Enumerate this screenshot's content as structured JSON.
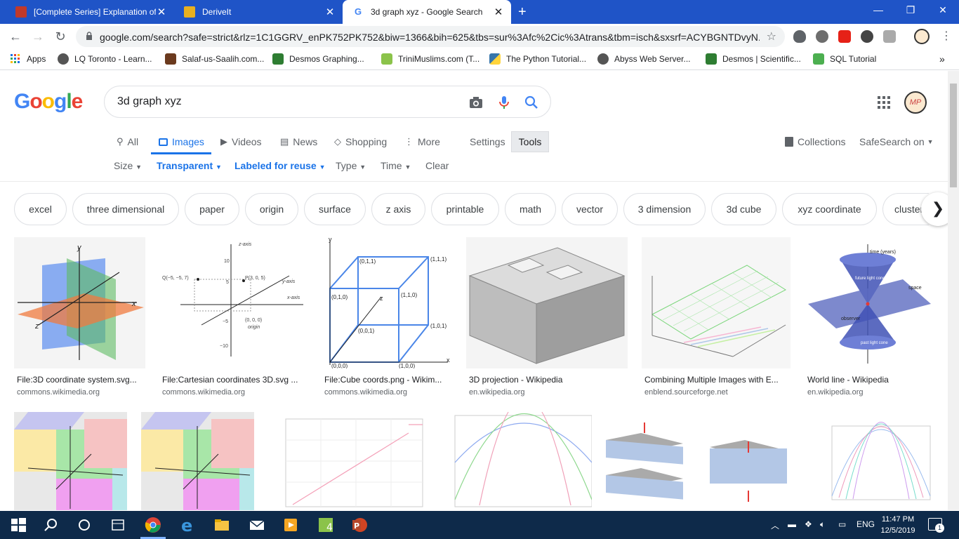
{
  "browser": {
    "tabs": [
      {
        "title": "[Complete Series] Explanation of",
        "active": false
      },
      {
        "title": "DeriveIt",
        "active": false
      },
      {
        "title": "3d graph xyz - Google Search",
        "active": true
      }
    ],
    "url": "google.com/search?safe=strict&rlz=1C1GGRV_enPK752PK752&biw=1366&bih=625&tbs=sur%3Afc%2Cic%3Atrans&tbm=isch&sxsrf=ACYBGNTDvyN...",
    "bookmarks": [
      "Apps",
      "LQ Toronto - Learn...",
      "Salaf-us-Saalih.com...",
      "Desmos Graphing...",
      "TriniMuslims.com (T...",
      "The Python Tutorial...",
      "Abyss Web Server...",
      "Desmos | Scientific...",
      "SQL Tutorial"
    ]
  },
  "google": {
    "logo": "Google",
    "query": "3d graph xyz",
    "avatar_initials": "MP",
    "tabs": [
      "All",
      "Images",
      "Videos",
      "News",
      "Shopping",
      "More"
    ],
    "settings": "Settings",
    "tools": "Tools",
    "collections": "Collections",
    "safesearch": "SafeSearch on",
    "filters": [
      "Size",
      "Transparent",
      "Labeled for reuse",
      "Type",
      "Time",
      "Clear"
    ],
    "chips": [
      "excel",
      "three dimensional",
      "paper",
      "origin",
      "surface",
      "z axis",
      "printable",
      "math",
      "vector",
      "3 dimension",
      "3d cube",
      "xyz coordinate",
      "cluster"
    ],
    "results": [
      {
        "title": "File:3D coordinate system.svg...",
        "source": "commons.wikimedia.org"
      },
      {
        "title": "File:Cartesian coordinates 3D.svg ...",
        "source": "commons.wikimedia.org"
      },
      {
        "title": "File:Cube coords.png - Wikim...",
        "source": "commons.wikimedia.org"
      },
      {
        "title": "3D projection - Wikipedia",
        "source": "en.wikipedia.org"
      },
      {
        "title": "Combining Multiple Images with E...",
        "source": "enblend.sourceforge.net"
      },
      {
        "title": "World line - Wikipedia",
        "source": "en.wikipedia.org"
      }
    ],
    "thumb_text": {
      "cart": {
        "q": "Q(−5, −5, 7)",
        "p": "P(3, 0, 5)",
        "zaxis": "z-axis",
        "yaxis": "y-axis",
        "xaxis": "x-axis",
        "origin": "(0, 0, 0)",
        "originlbl": "origin",
        "n10": "10",
        "n5": "5",
        "m5": "−5",
        "m10": "−10"
      },
      "cube": {
        "y": "y",
        "x": "x",
        "z": "z",
        "p010": "(0,1,0)",
        "p011": "(0,1,1)",
        "p111": "(1,1,1)",
        "p110": "(1,1,0)",
        "p001": "(0,0,1)",
        "p101": "(1,0,1)",
        "p000": "(0,0,0)",
        "p100": "(1,0,0)"
      },
      "world": {
        "time": "time (years)",
        "future": "future light cone",
        "past": "past light cone",
        "observer": "observer",
        "space": "space"
      },
      "coord": {
        "x": "x",
        "y": "y",
        "z": "z"
      }
    }
  },
  "taskbar": {
    "lang": "ENG",
    "time": "11:47 PM",
    "date": "12/5/2019",
    "notifications": "1"
  }
}
